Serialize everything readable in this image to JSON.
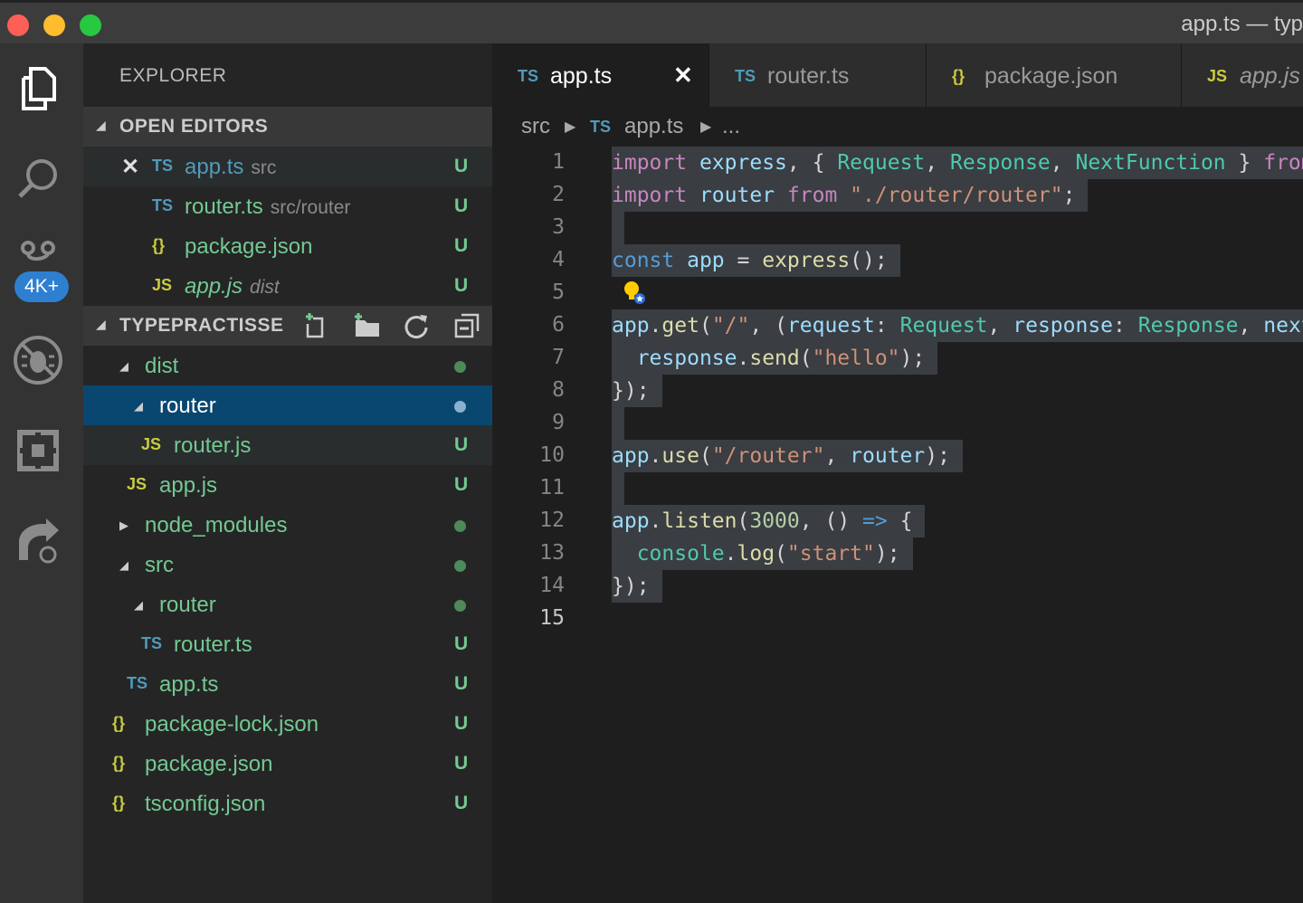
{
  "window": {
    "title": "app.ts — typ"
  },
  "activity_bar": {
    "badge": "4K+"
  },
  "sidebar": {
    "title": "EXPLORER",
    "open_editors": {
      "header": "OPEN EDITORS",
      "items": [
        {
          "icon": "TS",
          "name": "app.ts",
          "desc": "src",
          "status": "U"
        },
        {
          "icon": "TS",
          "name": "router.ts",
          "desc": "src/router",
          "status": "U"
        },
        {
          "icon": "{}",
          "name": "package.json",
          "desc": "",
          "status": "U"
        },
        {
          "icon": "JS",
          "name": "app.js",
          "desc": "dist",
          "status": "U"
        }
      ]
    },
    "project": {
      "header": "TYPEPRACTISSE",
      "items": [
        {
          "name": "dist",
          "icon": "",
          "status": ""
        },
        {
          "name": "router",
          "icon": "",
          "status": ""
        },
        {
          "name": "router.js",
          "icon": "JS",
          "status": "U"
        },
        {
          "name": "app.js",
          "icon": "JS",
          "status": "U"
        },
        {
          "name": "node_modules",
          "icon": "",
          "status": ""
        },
        {
          "name": "src",
          "icon": "",
          "status": ""
        },
        {
          "name": "router",
          "icon": "",
          "status": ""
        },
        {
          "name": "router.ts",
          "icon": "TS",
          "status": "U"
        },
        {
          "name": "app.ts",
          "icon": "TS",
          "status": "U"
        },
        {
          "name": "package-lock.json",
          "icon": "{}",
          "status": "U"
        },
        {
          "name": "package.json",
          "icon": "{}",
          "status": "U"
        },
        {
          "name": "tsconfig.json",
          "icon": "{}",
          "status": "U"
        }
      ]
    }
  },
  "tabs": [
    {
      "icon": "TS",
      "label": "app.ts",
      "close": "✕"
    },
    {
      "icon": "TS",
      "label": "router.ts"
    },
    {
      "icon": "{}",
      "label": "package.json"
    },
    {
      "icon": "JS",
      "label": "app.js"
    }
  ],
  "breadcrumb": {
    "folder": "src",
    "icon": "TS",
    "file": "app.ts",
    "more": "..."
  },
  "editor": {
    "line_numbers": [
      "1",
      "2",
      "3",
      "4",
      "5",
      "6",
      "7",
      "8",
      "9",
      "10",
      "11",
      "12",
      "13",
      "14",
      "15"
    ],
    "lines": [
      "import express, { Request, Response, NextFunction } from \"express\";",
      "import router from \"./router/router\";",
      "",
      "const app = express();",
      "",
      "app.get(\"/\", (request: Request, response: Response, next: NextFunction) => {",
      "  response.send(\"hello\");",
      "});",
      "",
      "app.use(\"/router\", router);",
      "",
      "app.listen(3000, () => {",
      "  console.log(\"start\");",
      "});",
      ""
    ]
  }
}
